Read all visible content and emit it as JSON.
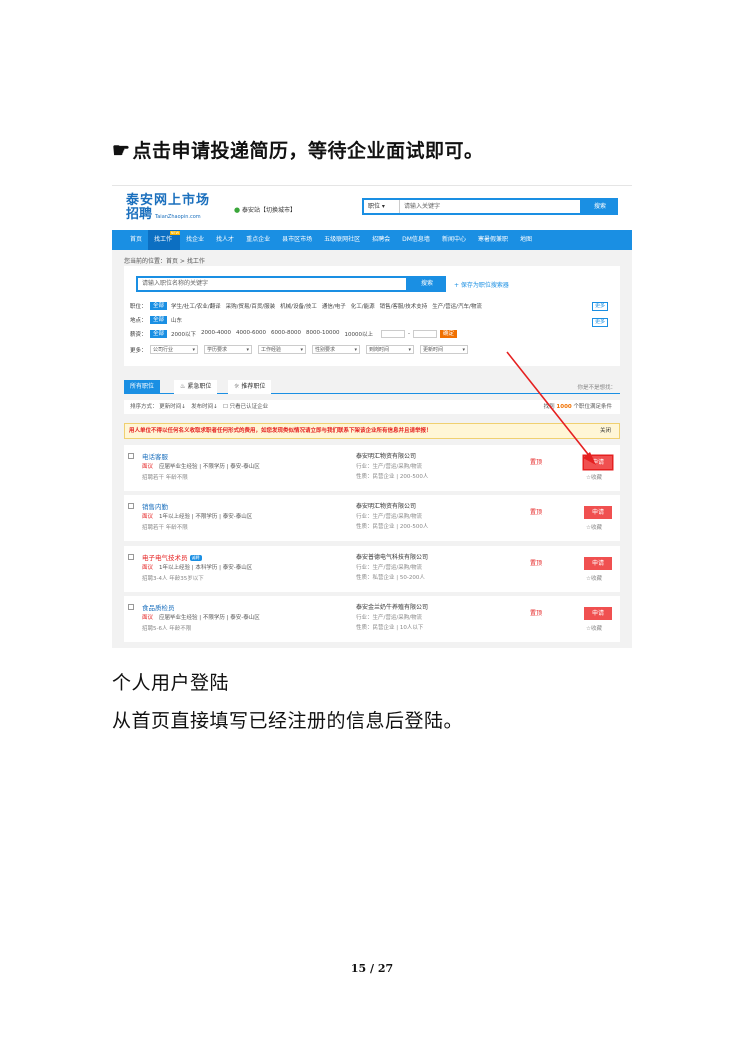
{
  "instruction": {
    "icon": "pointing-hand-icon",
    "text": "点击申请投递简历，等待企业面试即可。"
  },
  "screenshot": {
    "logo": {
      "main": "泰安网上市场",
      "sub": "招聘",
      "url": "TaianZhaopin.com"
    },
    "city": {
      "name": "泰安站",
      "switch": "【切换城市】"
    },
    "search": {
      "select": "职位",
      "placeholder": "请输入关键字",
      "button": "搜索"
    },
    "nav": [
      {
        "label": "首页"
      },
      {
        "label": "找工作",
        "badge": "NEW"
      },
      {
        "label": "找企业"
      },
      {
        "label": "找人才"
      },
      {
        "label": "重点企业"
      },
      {
        "label": "县市区市场"
      },
      {
        "label": "五级联网社区"
      },
      {
        "label": "招聘会"
      },
      {
        "label": "DM信息墙"
      },
      {
        "label": "新闻中心"
      },
      {
        "label": "寒暑假兼职"
      },
      {
        "label": "地图"
      }
    ],
    "breadcrumb": "您当前的位置：首页 > 找工作",
    "filter": {
      "keyword_placeholder": "请输入职位名称的关键字",
      "keyword_button": "搜索",
      "save": "+ 保存为职位搜索器",
      "job_label": "职位：",
      "all": "全部",
      "job_options": [
        "学生/社工/农业/翻译",
        "采购/贸易/百货/服装",
        "机械/设备/技工",
        "通信/电子",
        "化工/能源",
        "销售/客服/技术支持",
        "生产/营运/汽车/物流"
      ],
      "more": "更多",
      "area_label": "地点：",
      "area_options": [
        "山东"
      ],
      "salary_label": "薪资：",
      "salary_options": [
        "2000以下",
        "2000-4000",
        "4000-6000",
        "6000-8000",
        "8000-10000",
        "10000以上"
      ],
      "range_sep": "-",
      "confirm": "确定",
      "more_label": "更多：",
      "dropdowns": [
        "公司行业",
        "学历要求",
        "工作经验",
        "性别要求",
        "到岗时间",
        "更新时间"
      ]
    },
    "tabs": {
      "all": "所有职位",
      "urgent": "紧急职位",
      "recommend": "推荐职位",
      "aside": "你是不是想找："
    },
    "sort": {
      "label": "排序方式：",
      "update": "更新时间↓",
      "publish": "发布时间↓",
      "verified": "只看已认证企业",
      "count_prefix": "找到",
      "count": "1000",
      "count_suffix": "个职位满足条件"
    },
    "notice": {
      "text": "用人单位不得以任何名义收取求职者任何形式的费用，如您发现类似情况请立即与我们联系下架该企业所有信息并且请举报！",
      "close": "关闭"
    },
    "jobs": [
      {
        "title": "电话客服",
        "salary": "面议",
        "exp": "应届毕业生经验",
        "edu": "不限学历",
        "loc": "泰安-泰山区",
        "meta": "招聘若干   年龄不限",
        "company": "泰安明汇物资有限公司",
        "industry": "行业：生产/营运/采购/物流",
        "nature": "性质：民营企业 | 200-500人",
        "tag": "置顶",
        "apply": "申请",
        "fav": "收藏"
      },
      {
        "title": "销售内勤",
        "salary": "面议",
        "exp": "1年以上经验",
        "edu": "不限学历",
        "loc": "泰安-泰山区",
        "meta": "招聘若干   年龄不限",
        "company": "泰安明汇物资有限公司",
        "industry": "行业：生产/营运/采购/物流",
        "nature": "性质：民营企业 | 200-500人",
        "tag": "置顶",
        "apply": "申请",
        "fav": "收藏"
      },
      {
        "title": "电子电气技术员",
        "badge": "诚聘",
        "salary": "面议",
        "exp": "1年以上经验",
        "edu": "本科学历",
        "loc": "泰安-泰山区",
        "meta": "招聘3-4人   年龄35岁以下",
        "company": "泰安普德电气科技有限公司",
        "industry": "行业：生产/营运/采购/物流",
        "nature": "性质：私营企业 | 50-200人",
        "tag": "置顶",
        "apply": "申请",
        "fav": "收藏"
      },
      {
        "title": "食品质检员",
        "salary": "面议",
        "exp": "应届毕业生经验",
        "edu": "不限学历",
        "loc": "泰安-泰山区",
        "meta": "招聘5-6人   年龄不限",
        "company": "泰安金兰奶牛养殖有限公司",
        "industry": "行业：生产/营运/采购/物流",
        "nature": "性质：民营企业 | 10人以下",
        "tag": "置顶",
        "apply": "申请",
        "fav": "收藏"
      }
    ]
  },
  "section_title": "个人用户登陆",
  "section_desc": "从首页直接填写已经注册的信息后登陆。",
  "page_number": "15 / 27"
}
